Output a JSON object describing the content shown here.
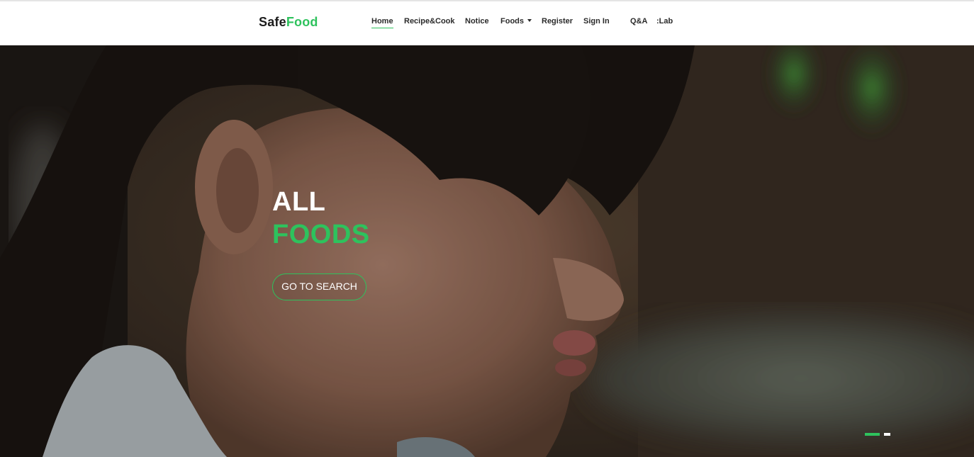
{
  "brand": {
    "part1": "Safe",
    "part2": "Food",
    "accent_color": "#2ec25d"
  },
  "nav": {
    "home": "Home",
    "recipe_cook": "Recipe&Cook",
    "notice": "Notice",
    "foods": "Foods",
    "register": "Register",
    "sign_in": "Sign In",
    "qna": "Q&A",
    "lab": ":Lab"
  },
  "hero": {
    "line1": "ALL",
    "line2": "FOODS",
    "cta_label": "GO TO SEARCH",
    "slides": {
      "count": 2,
      "active_index": 0
    }
  }
}
